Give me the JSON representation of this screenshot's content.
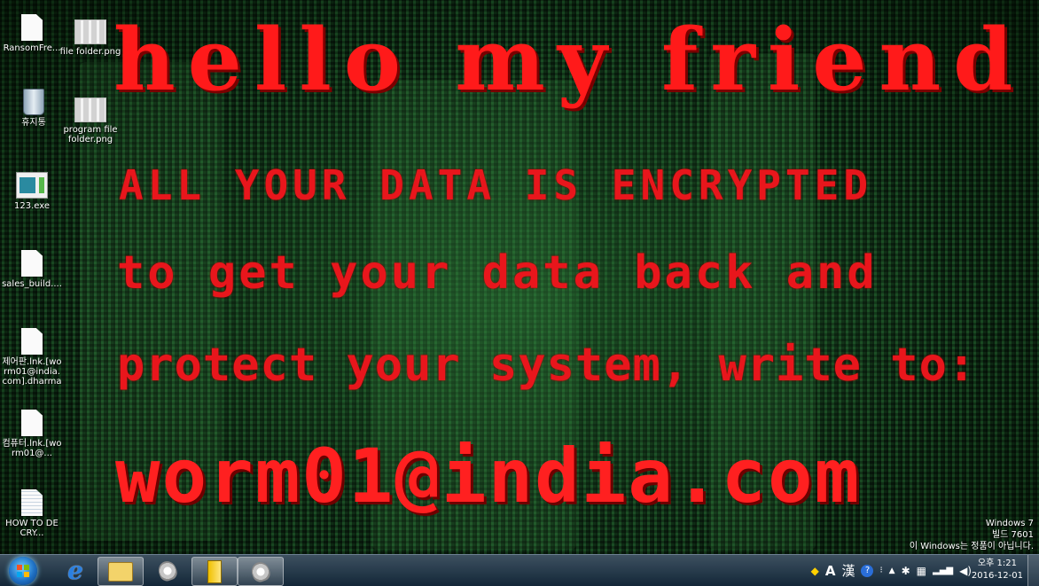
{
  "message": {
    "headline": "hello my friend",
    "line1": "ALL  YOUR  DATA  IS  ENCRYPTED",
    "line2": "to  get  your  data  back  and",
    "line3": "protect your system, write to:",
    "email": "worm01@india.com"
  },
  "desktop_icons": [
    {
      "label": "RansomFre...",
      "icon": "document-icon"
    },
    {
      "label": "file folder.png",
      "icon": "image-file-icon"
    },
    {
      "label": "휴지통",
      "icon": "recycle-bin-icon"
    },
    {
      "label": "program file folder.png",
      "icon": "image-file-icon"
    },
    {
      "label": "123.exe",
      "icon": "application-icon"
    },
    {
      "label": "sales_build....",
      "icon": "document-icon"
    },
    {
      "label": "제어판.lnk.[worm01@india.com].dharma",
      "icon": "document-icon"
    },
    {
      "label": "컴퓨터.lnk.[worm01@...",
      "icon": "document-icon"
    },
    {
      "label": "HOW TO DECRY...",
      "icon": "text-file-icon"
    }
  ],
  "watermark": {
    "line1": "Windows 7",
    "line2": "빌드 7601",
    "line3": "이 Windows는 정품이 아닙니다."
  },
  "taskbar": {
    "pinned": [
      "start-orb",
      "internet-explorer-icon",
      "windows-explorer-icon",
      "paint-icon",
      "folder-icon",
      "paint-icon"
    ],
    "tray": {
      "ime_lang": "A",
      "ime_hanja": "漢",
      "help": "?",
      "arrow": "▲"
    },
    "clock": {
      "time": "오후 1:21",
      "date": "2016-12-01"
    }
  },
  "colors": {
    "message_red": "#e8161c",
    "wallpaper_green": "#10301a"
  }
}
